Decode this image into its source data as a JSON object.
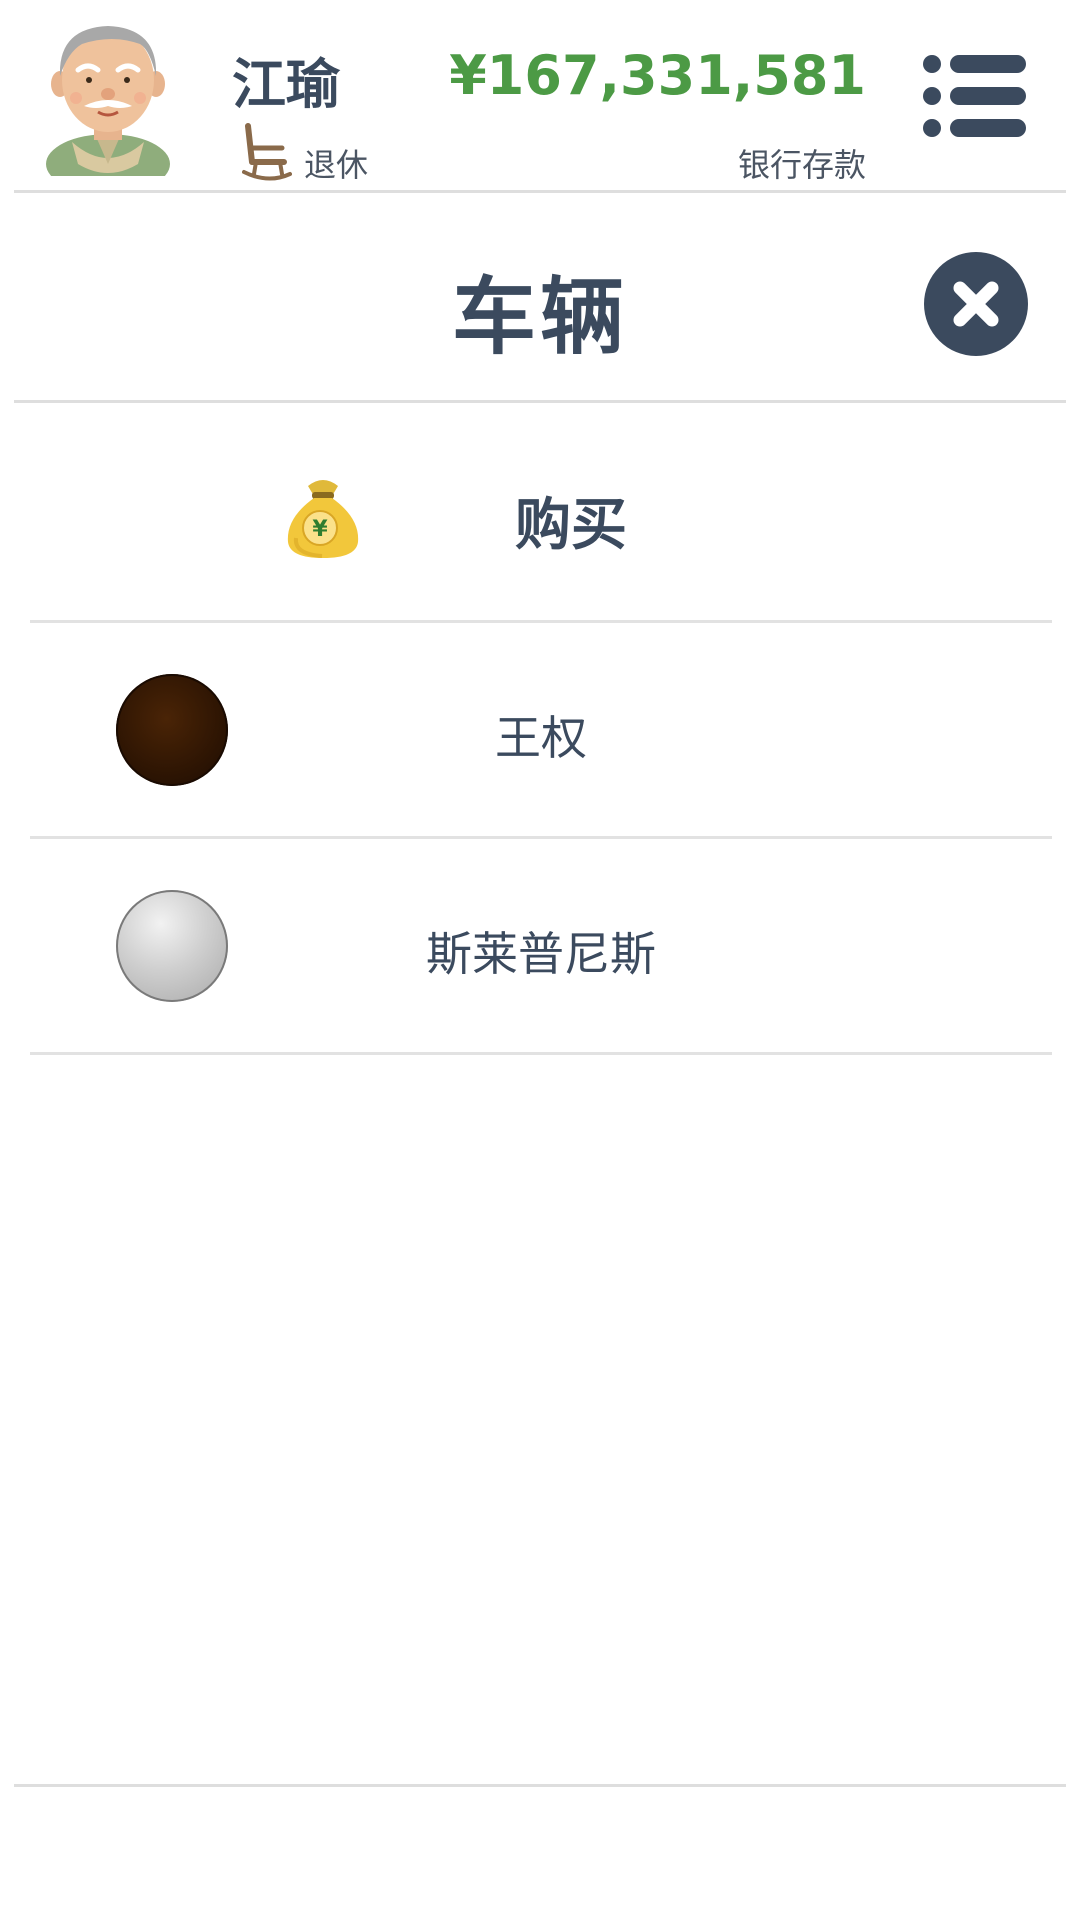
{
  "header": {
    "player_name": "江瑜",
    "status_label": "退休",
    "balance": "¥167,331,581",
    "balance_label": "银行存款"
  },
  "title": "车辆",
  "buy_label": "购买",
  "vehicles": [
    {
      "name": "王权",
      "color": "#2e1503"
    },
    {
      "name": "斯莱普尼斯",
      "color": "#bdbdbd"
    }
  ],
  "colors": {
    "text": "#3b4a5e",
    "money": "#4c9a45",
    "divider": "#dedede",
    "close_button": "#3b4a5e"
  },
  "icons": {
    "avatar": "old-man-avatar",
    "status": "rocking-chair-icon",
    "menu": "menu-list-icon",
    "close": "close-icon",
    "buy": "money-bag-icon"
  }
}
